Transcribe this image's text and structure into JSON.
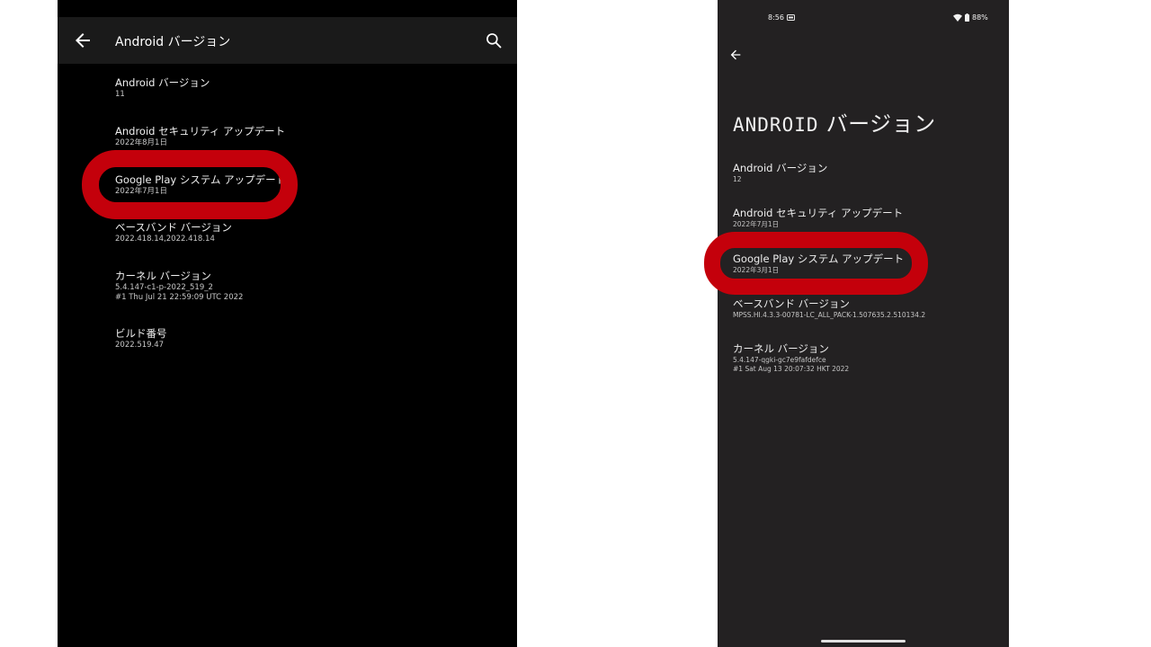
{
  "left_screen": {
    "app_bar": {
      "title": "Android バージョン",
      "back_icon": "arrow-back-icon",
      "search_icon": "search-icon"
    },
    "items": [
      {
        "title": "Android バージョン",
        "value": "11"
      },
      {
        "title": "Android セキュリティ アップデート",
        "value": "2022年8月1日"
      },
      {
        "title": "Google Play システム アップデート",
        "value": "2022年7月1日"
      },
      {
        "title": "ベースバンド バージョン",
        "value": "2022.418.14,2022.418.14"
      },
      {
        "title": "カーネル バージョン",
        "value": "5.4.147-c1-p-2022_519_2",
        "value2": "#1 Thu Jul 21 22:59:09 UTC 2022"
      },
      {
        "title": "ビルド番号",
        "value": "2022.519.47"
      }
    ]
  },
  "right_screen": {
    "status_bar": {
      "time": "8:56",
      "battery": "88%"
    },
    "back_icon": "arrow-back-icon",
    "page_title_latin": "ANDROID",
    "page_title_jp": " バージョン",
    "items": [
      {
        "title": "Android バージョン",
        "value": "12"
      },
      {
        "title": "Android セキュリティ アップデート",
        "value": "2022年7月1日"
      },
      {
        "title": "Google Play システム アップデート",
        "value": "2022年3月1日"
      },
      {
        "title": "ベースバンド バージョン",
        "value": "MPSS.HI.4.3.3-00781-LC_ALL_PACK-1.507635.2.510134.2"
      },
      {
        "title": "カーネル バージョン",
        "value": "5.4.147-qgki-gc7e9fafdefce",
        "value2": "#1 Sat Aug 13 20:07:32 HKT 2022"
      }
    ]
  },
  "colors": {
    "left_background": "#000000",
    "left_app_bar": "#1a1a1a",
    "right_background": "#232122",
    "highlight": "#c4000b"
  }
}
